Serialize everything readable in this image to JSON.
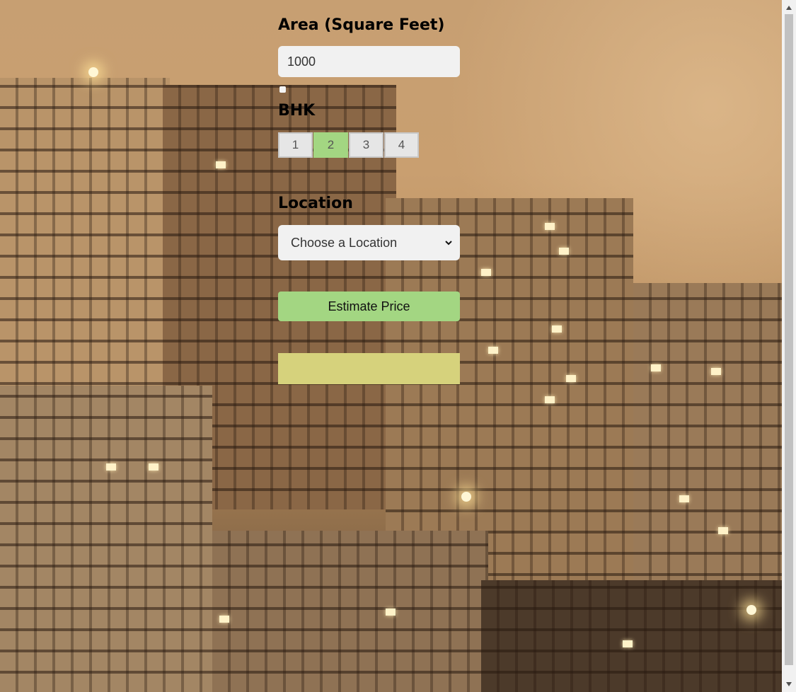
{
  "form": {
    "area_label": "Area (Square Feet)",
    "area_value": "1000",
    "bhk_label": "BHK",
    "bhk_options": [
      "1",
      "2",
      "3",
      "4"
    ],
    "bhk_selected": "2",
    "location_label": "Location",
    "location_selected": "Choose a Location",
    "estimate_button": "Estimate Price",
    "result_text": ""
  },
  "icons": {
    "select_arrow": "chevron-down-icon",
    "scroll_up": "triangle-up-icon",
    "scroll_down": "triangle-down-icon"
  },
  "colors": {
    "accent_green": "#a3d682",
    "result_bg": "#d6d27c",
    "input_bg": "#f1f1f1"
  }
}
